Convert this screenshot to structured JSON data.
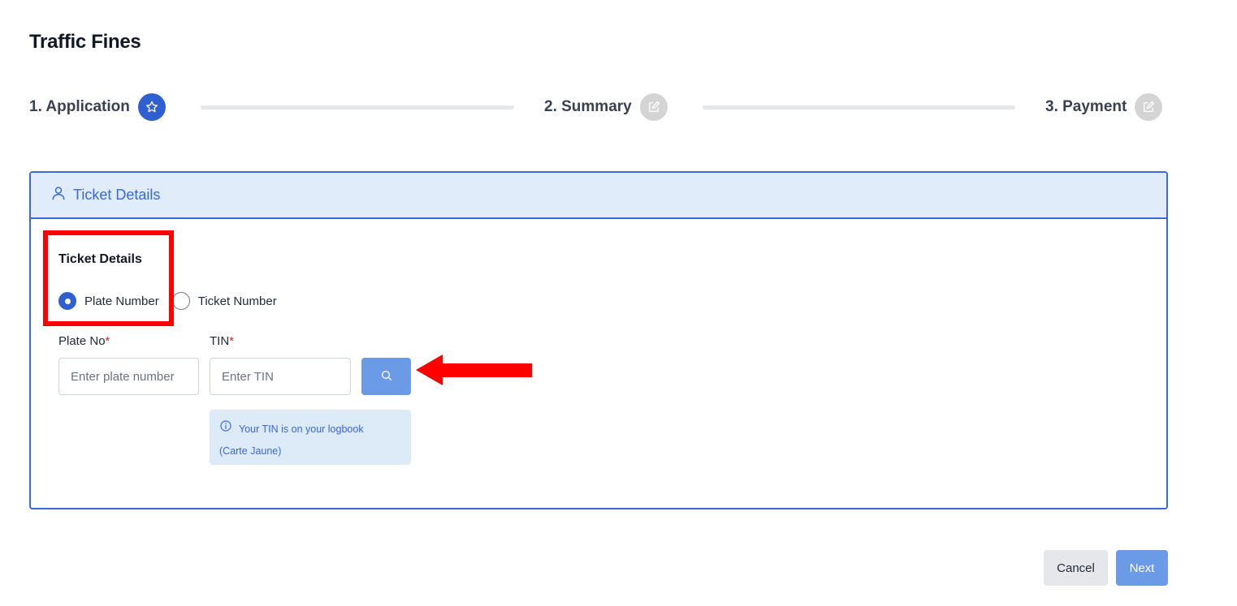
{
  "page": {
    "title": "Traffic Fines"
  },
  "stepper": {
    "steps": [
      {
        "label": "1. Application",
        "icon": "star-icon",
        "state": "active"
      },
      {
        "label": "2. Summary",
        "icon": "edit-icon",
        "state": "inactive"
      },
      {
        "label": "3. Payment",
        "icon": "edit-icon",
        "state": "inactive"
      }
    ]
  },
  "card": {
    "header_title": "Ticket Details",
    "header_icon": "user-icon",
    "section_label": "Ticket Details",
    "search_type": {
      "options": [
        {
          "label": "Plate Number",
          "checked": true
        },
        {
          "label": "Ticket Number",
          "checked": false
        }
      ]
    },
    "plate": {
      "label": "Plate No",
      "required_mark": "*",
      "placeholder": "Enter plate number",
      "value": ""
    },
    "tin": {
      "label": "TIN",
      "required_mark": "*",
      "placeholder": "Enter TIN",
      "value": ""
    },
    "search_button_icon": "search-icon",
    "info": {
      "icon": "info-icon",
      "line1": "Your TIN is on your logbook",
      "line2": "(Carte Jaune)"
    }
  },
  "actions": {
    "cancel_label": "Cancel",
    "next_label": "Next"
  },
  "colors": {
    "primary": "#2f5fd0",
    "primary_light": "#6b9be6",
    "header_bg": "#e0ecf9",
    "annotation": "#ff0000",
    "required": "#dc2626"
  }
}
